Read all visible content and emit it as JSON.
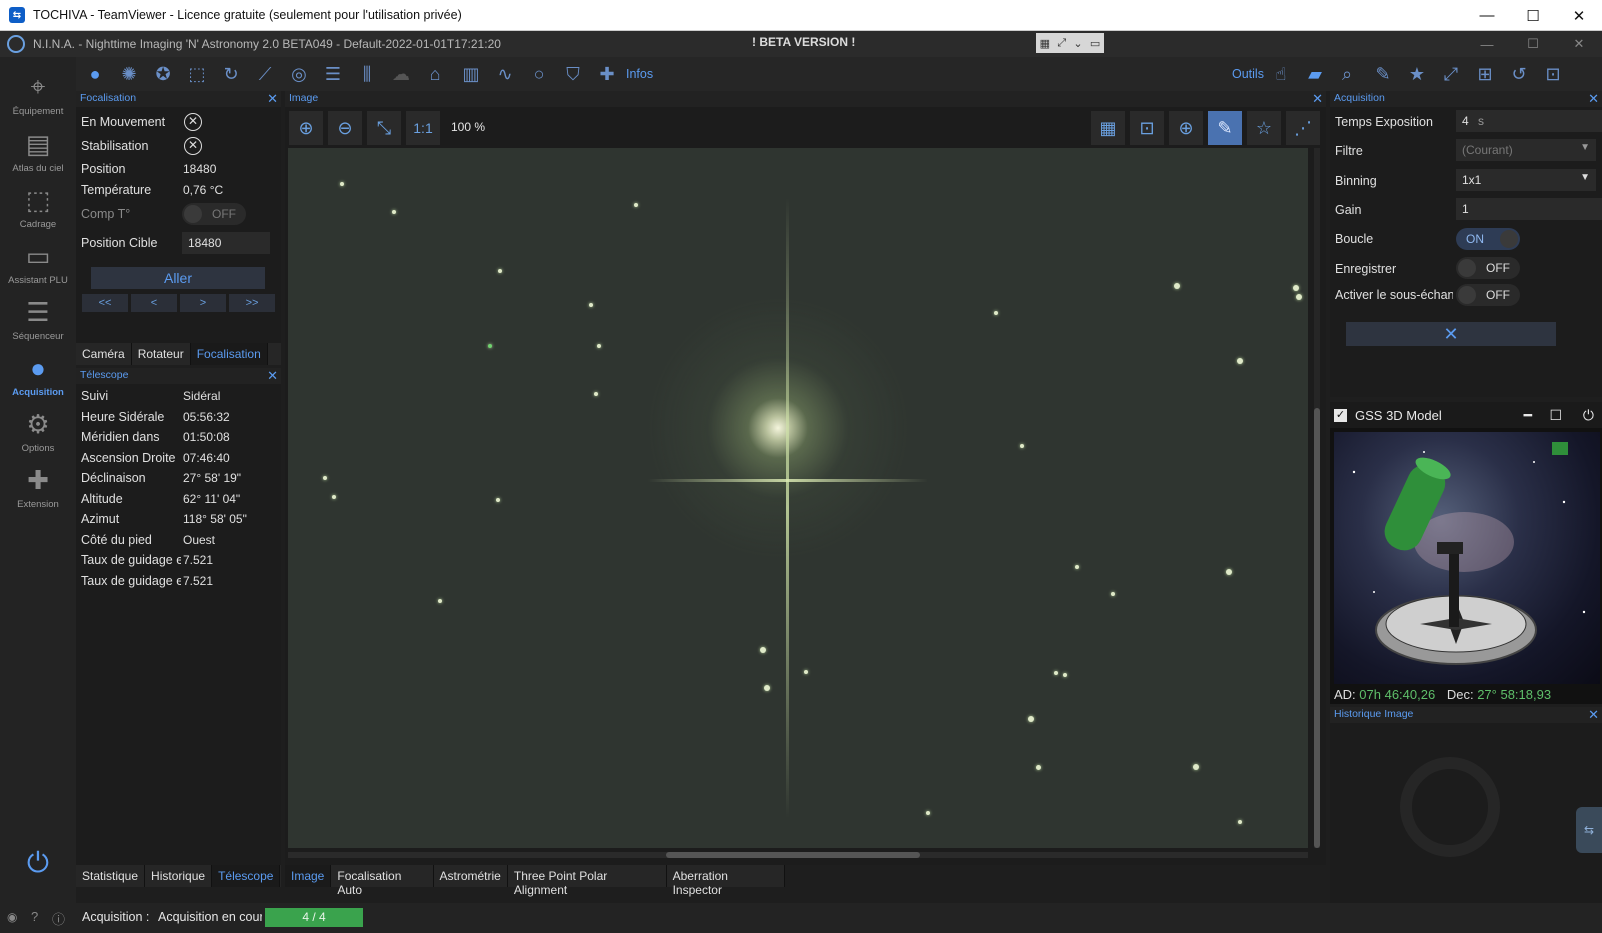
{
  "teamviewer": {
    "title": "TOCHIVA - TeamViewer - Licence gratuite (seulement pour l'utilisation privée)",
    "minimize": "—",
    "maximize": "☐",
    "close": "✕"
  },
  "nina": {
    "title": "N.I.N.A. - Nighttime Imaging 'N' Astronomy 2.0 BETA049  -  Default-2022-01-01T17:21:20",
    "beta": "! BETA VERSION !",
    "minimize": "—",
    "maximize": "☐",
    "close": "✕"
  },
  "nav": [
    {
      "label": "Équipement",
      "icon": "telescope-icon"
    },
    {
      "label": "Atlas du ciel",
      "icon": "map-icon"
    },
    {
      "label": "Cadrage",
      "icon": "frame-icon"
    },
    {
      "label": "Assistant PLU",
      "icon": "flat-icon"
    },
    {
      "label": "Séquenceur",
      "icon": "list-icon"
    },
    {
      "label": "Acquisition",
      "icon": "globe-icon"
    },
    {
      "label": "Options",
      "icon": "gear-icon"
    },
    {
      "label": "Extension",
      "icon": "puzzle-icon"
    }
  ],
  "toolbar": {
    "infos": "Infos",
    "outils": "Outils"
  },
  "focus_panel": {
    "title": "Focalisation",
    "en_mouvement": "En Mouvement",
    "stabilisation": "Stabilisation",
    "position_label": "Position",
    "position": "18480",
    "temperature_label": "Température",
    "temperature": "0,76 °C",
    "comp_label": "Comp T°",
    "comp_state": "OFF",
    "cible_label": "Position Cible",
    "cible_value": "18480",
    "aller": "Aller",
    "btns": [
      "<<",
      "<",
      ">",
      ">>"
    ],
    "tabs": [
      "Caméra",
      "Rotateur",
      "Focalisation"
    ]
  },
  "telescope_panel": {
    "title": "Télescope",
    "rows": [
      {
        "label": "Suivi",
        "value": "Sidéral"
      },
      {
        "label": "Heure Sidérale",
        "value": "05:56:32"
      },
      {
        "label": "Méridien dans",
        "value": "01:50:08"
      },
      {
        "label": "Ascension Droite",
        "value": "07:46:40"
      },
      {
        "label": "Déclinaison",
        "value": "27° 58' 19\""
      },
      {
        "label": "Altitude",
        "value": "62° 11' 04\""
      },
      {
        "label": "Azimut",
        "value": "118° 58' 05\""
      },
      {
        "label": "Côté du pied",
        "value": "Ouest"
      },
      {
        "label": "Taux de guidage er",
        "value": "7.521"
      },
      {
        "label": "Taux de guidage er",
        "value": "7.521"
      }
    ],
    "tabs": [
      "Statistique",
      "Historique",
      "Télescope"
    ]
  },
  "image_panel": {
    "title": "Image",
    "ratio": "1:1",
    "zoom": "100 %",
    "tabs": [
      "Image",
      "Focalisation Auto",
      "Astrométrie",
      "Three Point Polar Alignment",
      "Aberration Inspector"
    ]
  },
  "acquisition_panel": {
    "title": "Acquisition",
    "rows": [
      {
        "label": "Temps Exposition",
        "value": "4",
        "unit": "s"
      },
      {
        "label": "Filtre",
        "value": "(Courant)"
      },
      {
        "label": "Binning",
        "value": "1x1"
      },
      {
        "label": "Gain",
        "value": "1"
      },
      {
        "label": "Boucle",
        "value": "ON"
      },
      {
        "label": "Enregistrer",
        "value": "OFF"
      },
      {
        "label": "Activer le sous-échant",
        "value": "OFF"
      }
    ]
  },
  "gss": {
    "title": "GSS 3D Model",
    "ad_label": "AD:",
    "ad_value": "07h 46:40,26",
    "dec_label": "Dec:",
    "dec_value": "27° 58:18,93"
  },
  "historique": {
    "title": "Historique Image"
  },
  "status": {
    "label": "Acquisition :",
    "text": "Acquisition en cour",
    "progress": "4 / 4",
    "progress_fraction": 1.0
  },
  "colors": {
    "accent": "#5b9bf0",
    "progress": "#3aa34d",
    "coord": "#5fbf6a"
  }
}
